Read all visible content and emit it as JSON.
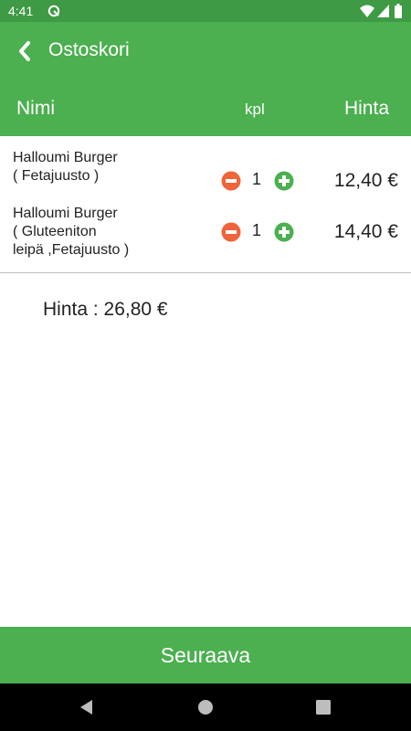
{
  "status_bar": {
    "time": "4:41"
  },
  "app_bar": {
    "title": "Ostoskori"
  },
  "table_header": {
    "name": "Nimi",
    "qty": "kpl",
    "price": "Hinta"
  },
  "items": [
    {
      "line1": "Halloumi Burger",
      "line2": "( Fetajuusto )",
      "line3": "",
      "qty": "1",
      "price": "12,40 €"
    },
    {
      "line1": "Halloumi Burger",
      "line2": "( Gluteeniton",
      "line3": "leipä ,Fetajuusto )",
      "qty": "1",
      "price": "14,40 €"
    }
  ],
  "total": "Hinta : 26,80 €",
  "next_button": "Seuraava",
  "icons": {
    "back": "chevron-left-icon",
    "minus": "minus-circle-icon",
    "plus": "plus-circle-icon"
  },
  "colors": {
    "primary": "#4caf50",
    "status_bar": "#3e9a44",
    "minus": "#f0643a",
    "plus": "#4caf50"
  }
}
